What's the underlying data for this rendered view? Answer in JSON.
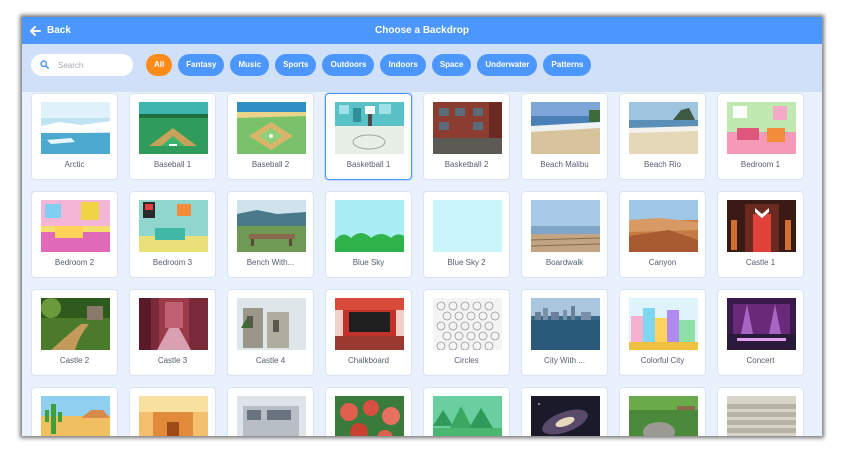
{
  "header": {
    "back_label": "Back",
    "title": "Choose a Backdrop"
  },
  "search": {
    "placeholder": "Search",
    "value": ""
  },
  "tags": [
    {
      "label": "All",
      "active": true
    },
    {
      "label": "Fantasy",
      "active": false
    },
    {
      "label": "Music",
      "active": false
    },
    {
      "label": "Sports",
      "active": false
    },
    {
      "label": "Outdoors",
      "active": false
    },
    {
      "label": "Indoors",
      "active": false
    },
    {
      "label": "Space",
      "active": false
    },
    {
      "label": "Underwater",
      "active": false
    },
    {
      "label": "Patterns",
      "active": false
    }
  ],
  "backdrops": [
    {
      "name": "Arctic",
      "thumbnail": "arctic-ice"
    },
    {
      "name": "Baseball 1",
      "thumbnail": "baseball-field"
    },
    {
      "name": "Baseball 2",
      "thumbnail": "baseball-diamond"
    },
    {
      "name": "Basketball 1",
      "thumbnail": "basketball-court",
      "selected": true
    },
    {
      "name": "Basketball 2",
      "thumbnail": "brick-court"
    },
    {
      "name": "Beach Malibu",
      "thumbnail": "beach-shore"
    },
    {
      "name": "Beach Rio",
      "thumbnail": "beach-mountain"
    },
    {
      "name": "Bedroom 1",
      "thumbnail": "pink-bedroom"
    },
    {
      "name": "Bedroom 2",
      "thumbnail": "yellow-bedroom"
    },
    {
      "name": "Bedroom 3",
      "thumbnail": "teal-bedroom"
    },
    {
      "name": "Bench With...",
      "thumbnail": "park-bench"
    },
    {
      "name": "Blue Sky",
      "thumbnail": "sky-hills"
    },
    {
      "name": "Blue Sky 2",
      "thumbnail": "plain-sky"
    },
    {
      "name": "Boardwalk",
      "thumbnail": "boardwalk"
    },
    {
      "name": "Canyon",
      "thumbnail": "canyon"
    },
    {
      "name": "Castle 1",
      "thumbnail": "castle-door"
    },
    {
      "name": "Castle 2",
      "thumbnail": "forest-path"
    },
    {
      "name": "Castle 3",
      "thumbnail": "castle-hall"
    },
    {
      "name": "Castle 4",
      "thumbnail": "ruins"
    },
    {
      "name": "Chalkboard",
      "thumbnail": "chalkboard"
    },
    {
      "name": "Circles",
      "thumbnail": "circle-pattern"
    },
    {
      "name": "City With ...",
      "thumbnail": "city-water"
    },
    {
      "name": "Colorful City",
      "thumbnail": "colorful-city"
    },
    {
      "name": "Concert",
      "thumbnail": "concert-stage"
    },
    {
      "name": "",
      "thumbnail": "desert-cactus"
    },
    {
      "name": "",
      "thumbnail": "desert-house"
    },
    {
      "name": "",
      "thumbnail": "modern-building"
    },
    {
      "name": "",
      "thumbnail": "flowers"
    },
    {
      "name": "",
      "thumbnail": "forest"
    },
    {
      "name": "",
      "thumbnail": "galaxy"
    },
    {
      "name": "",
      "thumbnail": "garden-rock"
    },
    {
      "name": "",
      "thumbnail": "stairs"
    }
  ],
  "colors": {
    "header_blue": "#4c97ff",
    "active_tag_orange": "#ff8c1a",
    "filter_bar": "#cfe0f8",
    "panel_bg": "#e9f1fc",
    "label_text": "#575e75"
  }
}
